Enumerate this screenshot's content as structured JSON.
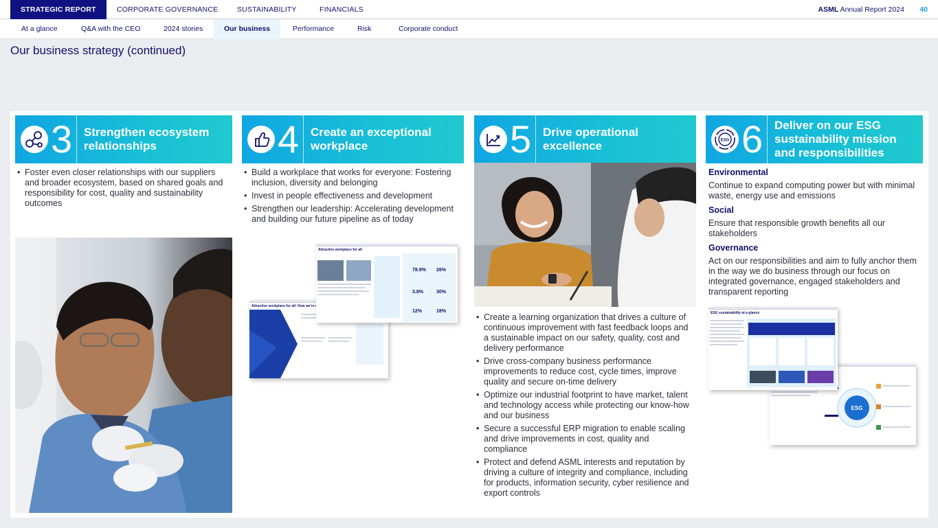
{
  "topnav": {
    "items": [
      "STRATEGIC REPORT",
      "CORPORATE GOVERNANCE",
      "SUSTAINABILITY",
      "FINANCIALS"
    ],
    "active": "STRATEGIC REPORT",
    "brand_name": "ASML",
    "brand_suffix": "Annual Report 2024",
    "page_number": "40"
  },
  "subnav": {
    "items": [
      "At a glance",
      "Q&A with the CEO",
      "2024 stories",
      "Our business",
      "Performance",
      "Risk",
      "Corporate conduct"
    ],
    "active": "Our business"
  },
  "page_title": "Our business strategy (continued)",
  "colors": {
    "navy": "#10106a",
    "accent_gradient_start": "#10a6e3",
    "accent_gradient_end": "#20c9cf",
    "page_number": "#1fa0e0"
  },
  "columns": [
    {
      "number": "3",
      "icon": "network-nodes-icon",
      "title": "Strengthen ecosystem relationships",
      "bullets": [
        "Foster even closer relationships with our suppliers and broader ecosystem, based on shared goals and responsibility for cost, quality and sustainability outcomes"
      ],
      "photo": "photo-lab-workers-gloves"
    },
    {
      "number": "4",
      "icon": "thumbs-up-icon",
      "title": "Create an exceptional workplace",
      "bullets": [
        "Build a workplace that works for everyone: Fostering inclusion, diversity and belonging",
        "Invest in people effectiveness and development",
        "Strengthen our leadership: Accelerating development and building our future pipeline as of today"
      ],
      "thumbnails": [
        {
          "title": "Attractive workplace for all"
        },
        {
          "title": "Attractive workplace for all: How we're managing"
        }
      ]
    },
    {
      "number": "5",
      "icon": "trend-chart-icon",
      "title": "Drive operational excellence",
      "photo": "photo-colleagues-smiling",
      "bullets": [
        "Create a learning organization that drives a culture of continuous improvement with fast feedback loops and a sustainable impact on our safety, quality, cost and delivery performance",
        "Drive cross-company business performance improvements to reduce cost, cycle times, improve quality and secure on-time delivery",
        "Optimize our industrial footprint to have market, talent and technology access while protecting our know-how and our business",
        "Secure a successful ERP migration to enable scaling and drive improvements in cost, quality and compliance",
        "Protect and defend ASML interests and reputation by driving a culture of integrity and compliance, including for products, information security, cyber resilience and export controls"
      ]
    },
    {
      "number": "6",
      "icon": "esg-circle-icon",
      "icon_text": "ESG",
      "title": "Deliver on our ESG sustainability mission and responsibilities",
      "sections": [
        {
          "heading": "Environmental",
          "text": "Continue to expand computing power but with minimal waste, energy use and emissions"
        },
        {
          "heading": "Social",
          "text": "Ensure that responsible growth benefits all our stakeholders"
        },
        {
          "heading": "Governance",
          "text": "Act on our responsibilities and aim to fully anchor them in the way we do business through our focus on integrated governance, engaged stakeholders and transparent reporting"
        }
      ],
      "thumbnails": [
        {
          "title": "ESG sustainability at a glance"
        },
        {
          "title": "",
          "badge": "ESG"
        }
      ]
    }
  ]
}
